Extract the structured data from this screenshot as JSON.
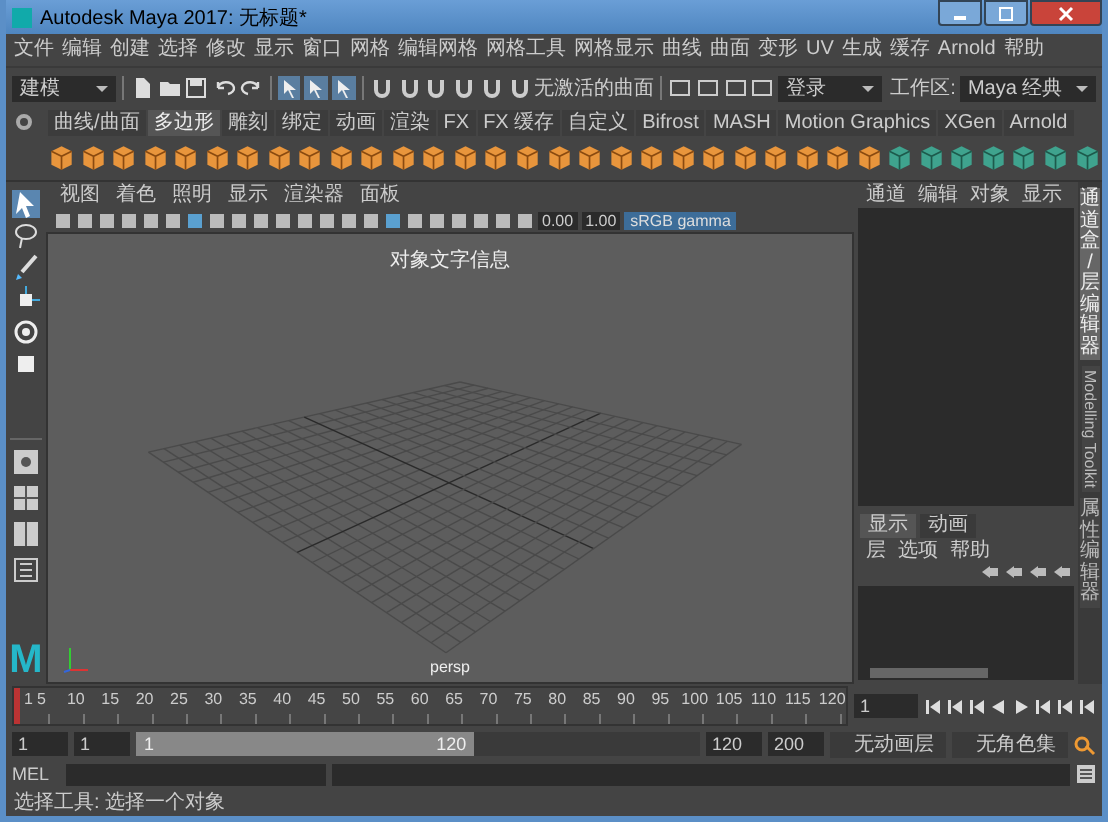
{
  "window": {
    "title": "Autodesk Maya 2017: 无标题*"
  },
  "menu_bar": [
    "文件",
    "编辑",
    "创建",
    "选择",
    "修改",
    "显示",
    "窗口",
    "网格",
    "编辑网格",
    "网格工具",
    "网格显示",
    "曲线",
    "曲面",
    "变形",
    "UV",
    "生成",
    "缓存",
    "Arnold",
    "帮助"
  ],
  "status_line": {
    "mode": "建模",
    "live_surface": "无激活的曲面",
    "login": "登录",
    "workspace_label": "工作区:",
    "workspace": "Maya 经典"
  },
  "shelf": {
    "tabs": [
      {
        "label": "曲线/曲面",
        "selected": false
      },
      {
        "label": "多边形",
        "selected": true
      },
      {
        "label": "雕刻",
        "selected": false
      },
      {
        "label": "绑定",
        "selected": false
      },
      {
        "label": "动画",
        "selected": false
      },
      {
        "label": "渲染",
        "selected": false
      },
      {
        "label": "FX",
        "selected": false
      },
      {
        "label": "FX 缓存",
        "selected": false
      },
      {
        "label": "自定义",
        "selected": false
      },
      {
        "label": "Bifrost",
        "selected": false
      },
      {
        "label": "MASH",
        "selected": false
      },
      {
        "label": "Motion Graphics",
        "selected": false
      },
      {
        "label": "XGen",
        "selected": false
      },
      {
        "label": "Arnold",
        "selected": false
      }
    ]
  },
  "viewport": {
    "menus": [
      "视图",
      "着色",
      "照明",
      "显示",
      "渲染器",
      "面板"
    ],
    "exposure": "0.00",
    "gamma": "1.00",
    "color_space": "sRGB gamma",
    "hud_text": "对象文字信息",
    "camera": "persp"
  },
  "channel_box": {
    "menus": [
      "通道",
      "编辑",
      "对象",
      "显示"
    ]
  },
  "layer_editor": {
    "tabs": [
      {
        "label": "显示",
        "selected": true
      },
      {
        "label": "动画",
        "selected": false
      }
    ],
    "menus": [
      "层",
      "选项",
      "帮助"
    ]
  },
  "side_tabs": [
    {
      "label": "通道盒/层编辑器",
      "selected": true
    },
    {
      "label": "Modelling Toolkit",
      "selected": false
    },
    {
      "label": "属性编辑器",
      "selected": false
    }
  ],
  "logo": "M",
  "time_slider": {
    "start_label": "1",
    "ticks": [
      "5",
      "10",
      "15",
      "20",
      "25",
      "30",
      "35",
      "40",
      "45",
      "50",
      "55",
      "60",
      "65",
      "70",
      "75",
      "80",
      "85",
      "90",
      "95",
      "100",
      "105",
      "110",
      "115",
      "120"
    ],
    "current_frame": "1",
    "level": 0
  },
  "range_slider": {
    "start": "1",
    "playback_start": "1",
    "bar_start": "1",
    "bar_end": "120",
    "playback_end": "120",
    "end": "200",
    "level": 0.6,
    "anim_layer": "无动画层",
    "character_set": "无角色集"
  },
  "command_line": {
    "language": "MEL"
  },
  "help_line": "选择工具: 选择一个对象"
}
